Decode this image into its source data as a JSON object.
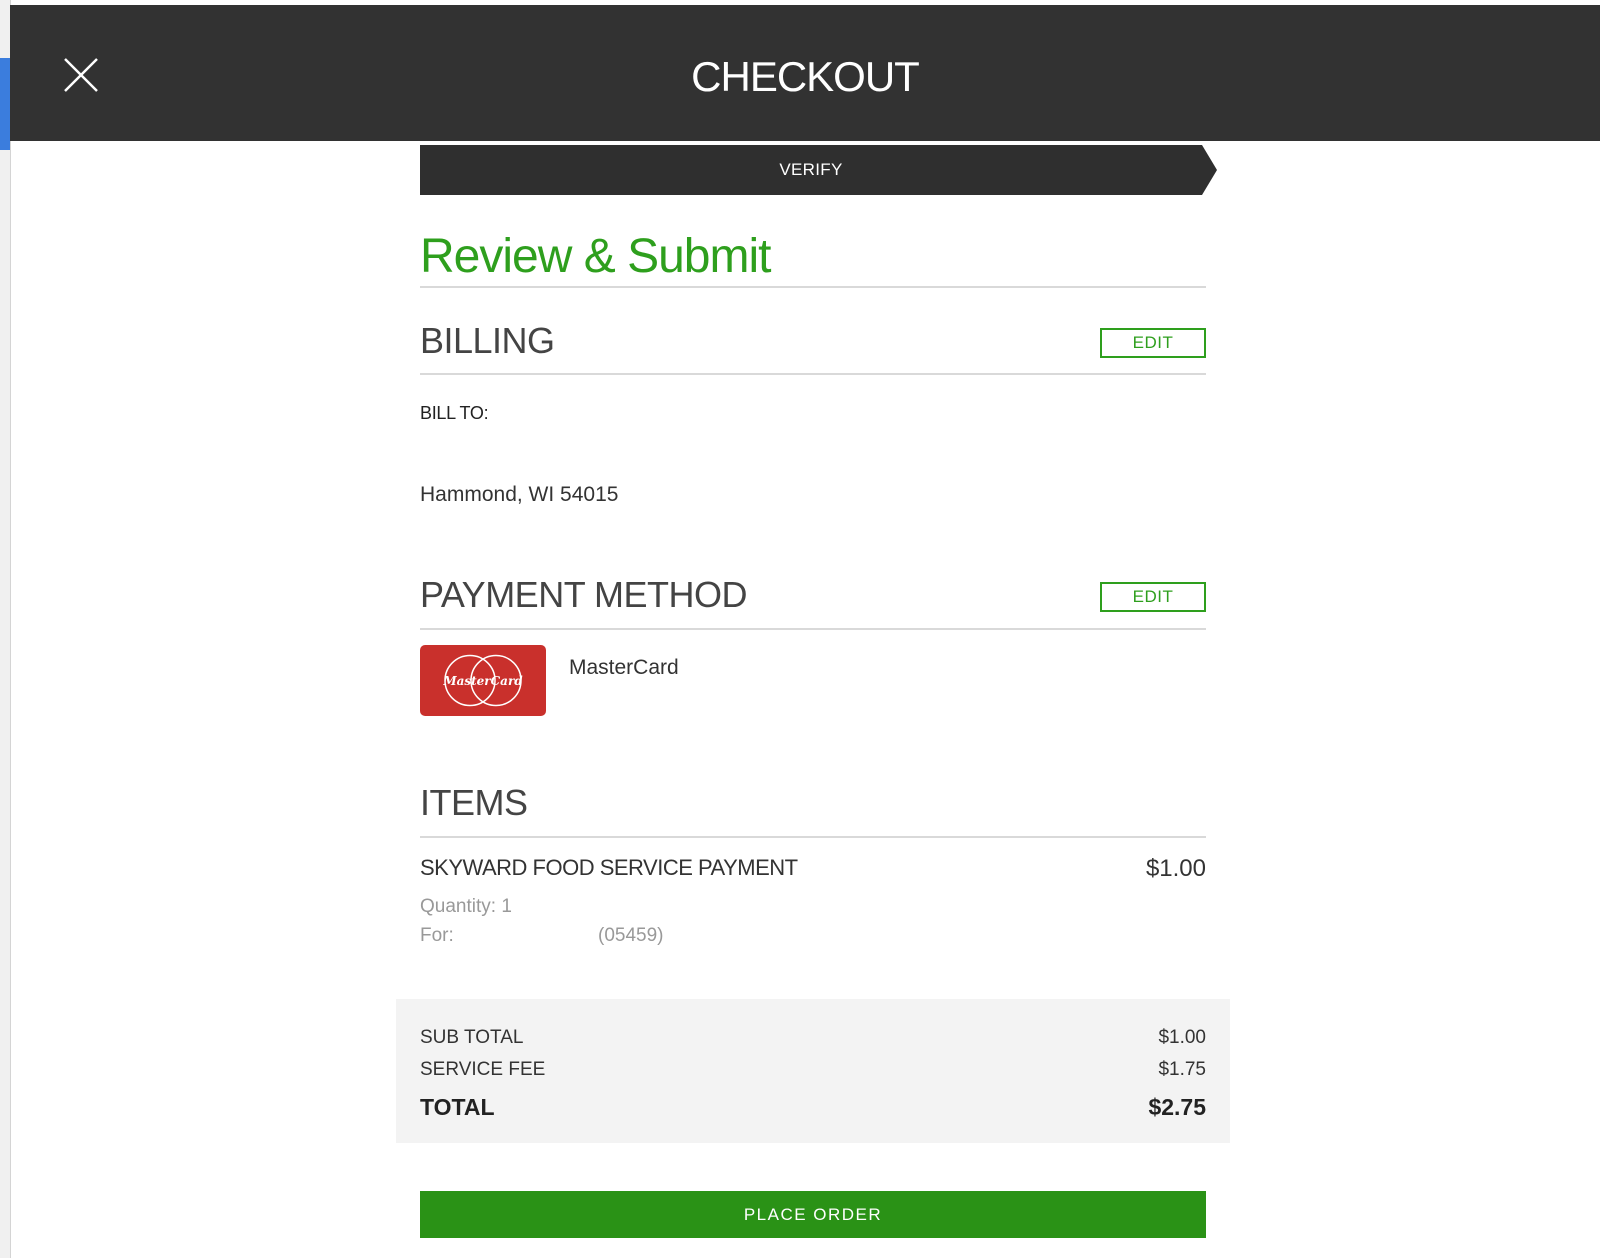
{
  "header": {
    "title": "CHECKOUT",
    "close_icon": "close-icon"
  },
  "progress": {
    "step_label": "VERIFY"
  },
  "review": {
    "title": "Review & Submit"
  },
  "billing": {
    "section_title": "BILLING",
    "edit_label": "EDIT",
    "bill_to_label": "BILL TO:",
    "city_line": "Hammond, WI 54015"
  },
  "payment": {
    "section_title": "PAYMENT METHOD",
    "edit_label": "EDIT",
    "card_logo_text": "MasterCard",
    "card_name": "MasterCard"
  },
  "items": {
    "section_title": "ITEMS",
    "list": [
      {
        "name": "SKYWARD FOOD SERVICE PAYMENT",
        "price": "$1.00",
        "quantity": "Quantity: 1",
        "for_label": "For:",
        "student_id": "(05459)"
      }
    ]
  },
  "totals": {
    "subtotal_label": "SUB TOTAL",
    "subtotal_value": "$1.00",
    "fee_label": "SERVICE FEE",
    "fee_value": "$1.75",
    "total_label": "TOTAL",
    "total_value": "$2.75"
  },
  "actions": {
    "place_order_label": "PLACE ORDER"
  },
  "colors": {
    "accent_green": "#2e9f1d",
    "button_green": "#2a9216",
    "header_bg": "#323232",
    "card_red": "#c9302c"
  }
}
